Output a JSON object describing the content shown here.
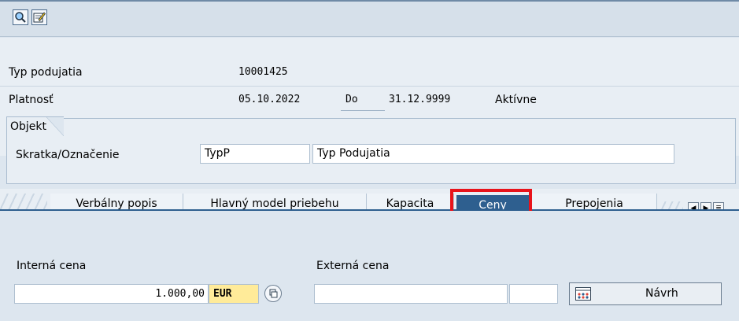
{
  "toolbar": {
    "buttons": [
      {
        "icon": "display-icon"
      },
      {
        "icon": "edit-icon"
      }
    ]
  },
  "header": {
    "event_type_label": "Typ podujatia",
    "event_type_value": "10001425",
    "validity_label": "Platnosť",
    "valid_from": "05.10.2022",
    "to_label": "Do",
    "valid_to": "31.12.9999",
    "status": "Aktívne"
  },
  "object": {
    "frame_title": "Objekt",
    "abbr_label": "Skratka/Označenie",
    "abbr_value": "TypP",
    "name_value": "Typ Podujatia"
  },
  "tabs": [
    {
      "label": "Verbálny popis",
      "active": false
    },
    {
      "label": "Hlavný model priebehu",
      "active": false
    },
    {
      "label": "Kapacita",
      "active": false
    },
    {
      "label": "Ceny",
      "active": true
    },
    {
      "label": "Prepojenia",
      "active": false
    }
  ],
  "prices": {
    "internal_label": "Interná cena",
    "internal_value": "1.000,00",
    "internal_currency": "EUR",
    "external_label": "Externá cena",
    "external_value": "",
    "external_currency": "",
    "proposal_button": "Návrh"
  },
  "colors": {
    "accent": "#2e5f8f",
    "highlight": "#e8131b",
    "currency_bg": "#ffeb99"
  }
}
